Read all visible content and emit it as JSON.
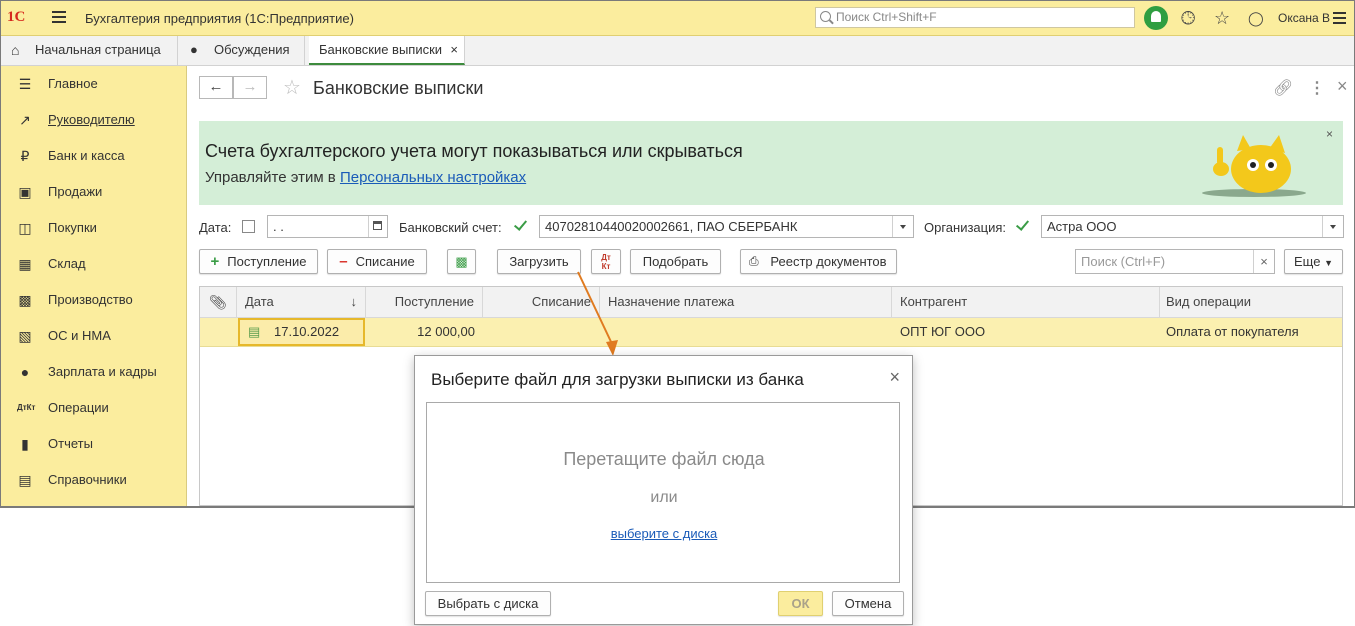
{
  "app": {
    "logo": "1С",
    "title": "Бухгалтерия предприятия  (1С:Предприятие)",
    "search_placeholder": "Поиск Ctrl+Shift+F",
    "user": "Оксана В"
  },
  "tabs": [
    {
      "label": "Начальная страница"
    },
    {
      "label": "Обсуждения"
    },
    {
      "label": "Банковские выписки",
      "close": "×"
    }
  ],
  "sidebar": {
    "items": [
      {
        "label": "Главное",
        "icon": "menu-icon"
      },
      {
        "label": "Руководителю",
        "icon": "trend-icon"
      },
      {
        "label": "Банк и касса",
        "icon": "ruble-icon"
      },
      {
        "label": "Продажи",
        "icon": "bag-icon"
      },
      {
        "label": "Покупки",
        "icon": "cart-icon"
      },
      {
        "label": "Склад",
        "icon": "grid-icon"
      },
      {
        "label": "Производство",
        "icon": "factory-icon"
      },
      {
        "label": "ОС и НМА",
        "icon": "box-icon"
      },
      {
        "label": "Зарплата и кадры",
        "icon": "person-icon"
      },
      {
        "label": "Операции",
        "icon": "dtkt-icon"
      },
      {
        "label": "Отчеты",
        "icon": "bars-icon"
      },
      {
        "label": "Справочники",
        "icon": "book-icon"
      }
    ]
  },
  "document": {
    "title": "Банковские выписки"
  },
  "banner": {
    "title": "Счета бухгалтерского учета могут показываться или скрываться",
    "text_prefix": "Управляйте этим в ",
    "link": "Персональных настройках",
    "close": "×"
  },
  "filters": {
    "date_label": "Дата:",
    "date_value": " .  .",
    "account_label": "Банковский счет:",
    "account_value": "40702810440020002661, ПАО СБЕРБАНК",
    "org_label": "Организация:",
    "org_value": "Астра ООО"
  },
  "toolbar": {
    "receipt": "Поступление",
    "writeoff": "Списание",
    "load": "Загрузить",
    "dt": "Дт",
    "kt": "Кт",
    "select": "Подобрать",
    "registry": "Реестр документов",
    "search_placeholder": "Поиск (Ctrl+F)",
    "clear": "×",
    "more": "Еще"
  },
  "table": {
    "columns": {
      "date": "Дата",
      "sort": "↓",
      "receipt": "Поступление",
      "writeoff": "Списание",
      "purpose": "Назначение платежа",
      "counterparty": "Контрагент",
      "operation": "Вид операции"
    },
    "rows": [
      {
        "date": "17.10.2022",
        "receipt": "12 000,00",
        "writeoff": "",
        "purpose": "",
        "counterparty": "ОПТ ЮГ ООО",
        "operation": "Оплата от покупателя"
      }
    ]
  },
  "dialog": {
    "title": "Выберите файл для загрузки выписки из банка",
    "close": "×",
    "drop_text": "Перетащите файл сюда",
    "or": "или",
    "link": "выберите с диска",
    "btn_choose": "Выбрать с диска",
    "btn_ok": "ОК",
    "btn_cancel": "Отмена"
  },
  "colors": {
    "accent_yellow": "#fbed9e",
    "banner_green": "#d4eed7",
    "row_highlight": "#fbf0b0",
    "arrow_orange": "#e07b20"
  }
}
